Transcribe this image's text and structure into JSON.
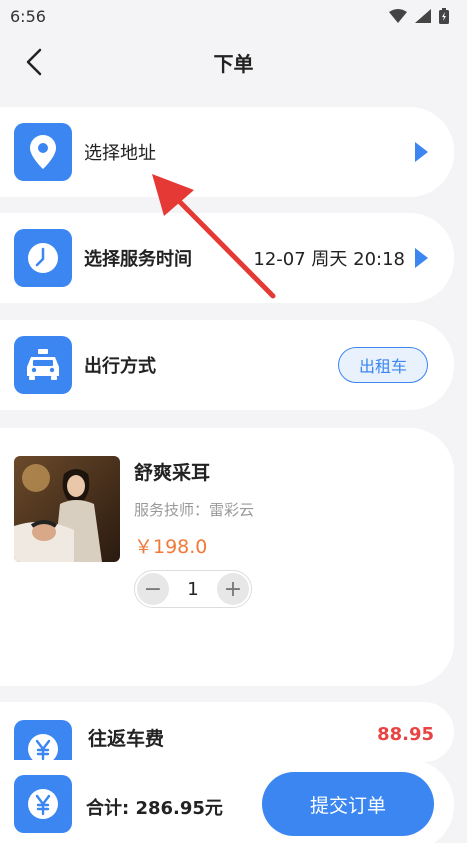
{
  "status_bar": {
    "time": "6:56",
    "icons": [
      "wifi-icon",
      "signal-icon",
      "battery-icon"
    ]
  },
  "nav": {
    "title": "下单",
    "back_icon": "back-arrow-icon"
  },
  "address": {
    "label": "选择地址",
    "icon": "location-pin-icon"
  },
  "service_time": {
    "label": "选择服务时间",
    "value": "12-07 周天 20:18",
    "icon": "clock-icon"
  },
  "travel": {
    "label": "出行方式",
    "option": "出租车",
    "icon": "taxi-icon"
  },
  "product": {
    "name": "舒爽采耳",
    "technician": "服务技师：雷彩云",
    "price": "￥198.0",
    "quantity": "1",
    "minus": "−",
    "plus": "+"
  },
  "fare": {
    "label": "往返车费",
    "amount": "88.95",
    "icon": "yuan-icon"
  },
  "footer": {
    "total": "合计: 286.95元",
    "submit_label": "提交订单",
    "icon": "yuan-icon"
  },
  "colors": {
    "accent": "#3b86f0",
    "price": "#f07a3a",
    "fare": "#e84444",
    "annotation": "#e53935"
  }
}
